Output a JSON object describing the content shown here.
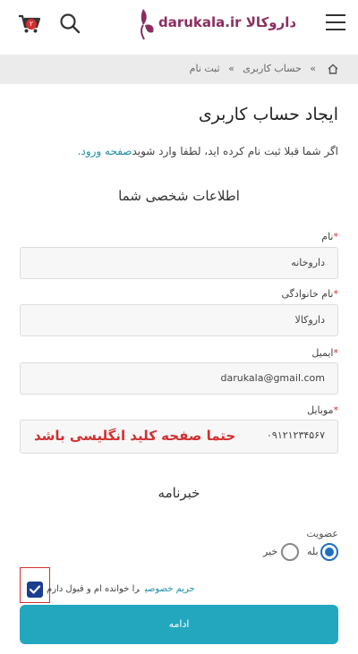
{
  "header": {
    "cart_count": "۲",
    "logo_text": "darukala.ir داروکالا",
    "brand_color": "#8b2e5e"
  },
  "breadcrumb": {
    "items": [
      "حساب کاربری",
      "»",
      "ثبت نام"
    ],
    "separator": "»"
  },
  "page": {
    "title": "ایجاد حساب کاربری",
    "login_hint_prefix": "اگر شما قبلا ثبت نام کرده اید، لطفا وارد شوید",
    "login_link": "صفحه ورود.",
    "personal_info_title": "اطلاعات شخصی شما",
    "newsletter_title": "خبرنامه"
  },
  "form": {
    "first_name": {
      "label": "نام",
      "required": "*",
      "value": "داروخانه"
    },
    "last_name": {
      "label": "نام خانوادگی",
      "required": "*",
      "value": "داروکالا"
    },
    "email": {
      "label": "ایمیل",
      "required": "*",
      "value": "darukala@gmail.com"
    },
    "mobile": {
      "label": "موبایل",
      "required": "*",
      "value": "۰۹۱۲۱۲۳۴۵۶۷",
      "note": "حتما صفحه کلید انگلیسی باشد"
    },
    "membership": {
      "label": "عضویت",
      "yes": "بله",
      "no": "خیر",
      "selected": "yes"
    },
    "terms": {
      "prefix": "را خوانده ام و قبول دارم",
      "link": "حریم خصوصی",
      "checked": true
    },
    "submit_label": "ادامه"
  },
  "colors": {
    "accent": "#22a7bf",
    "required": "#d32f2f",
    "link": "#1f8fa6"
  }
}
